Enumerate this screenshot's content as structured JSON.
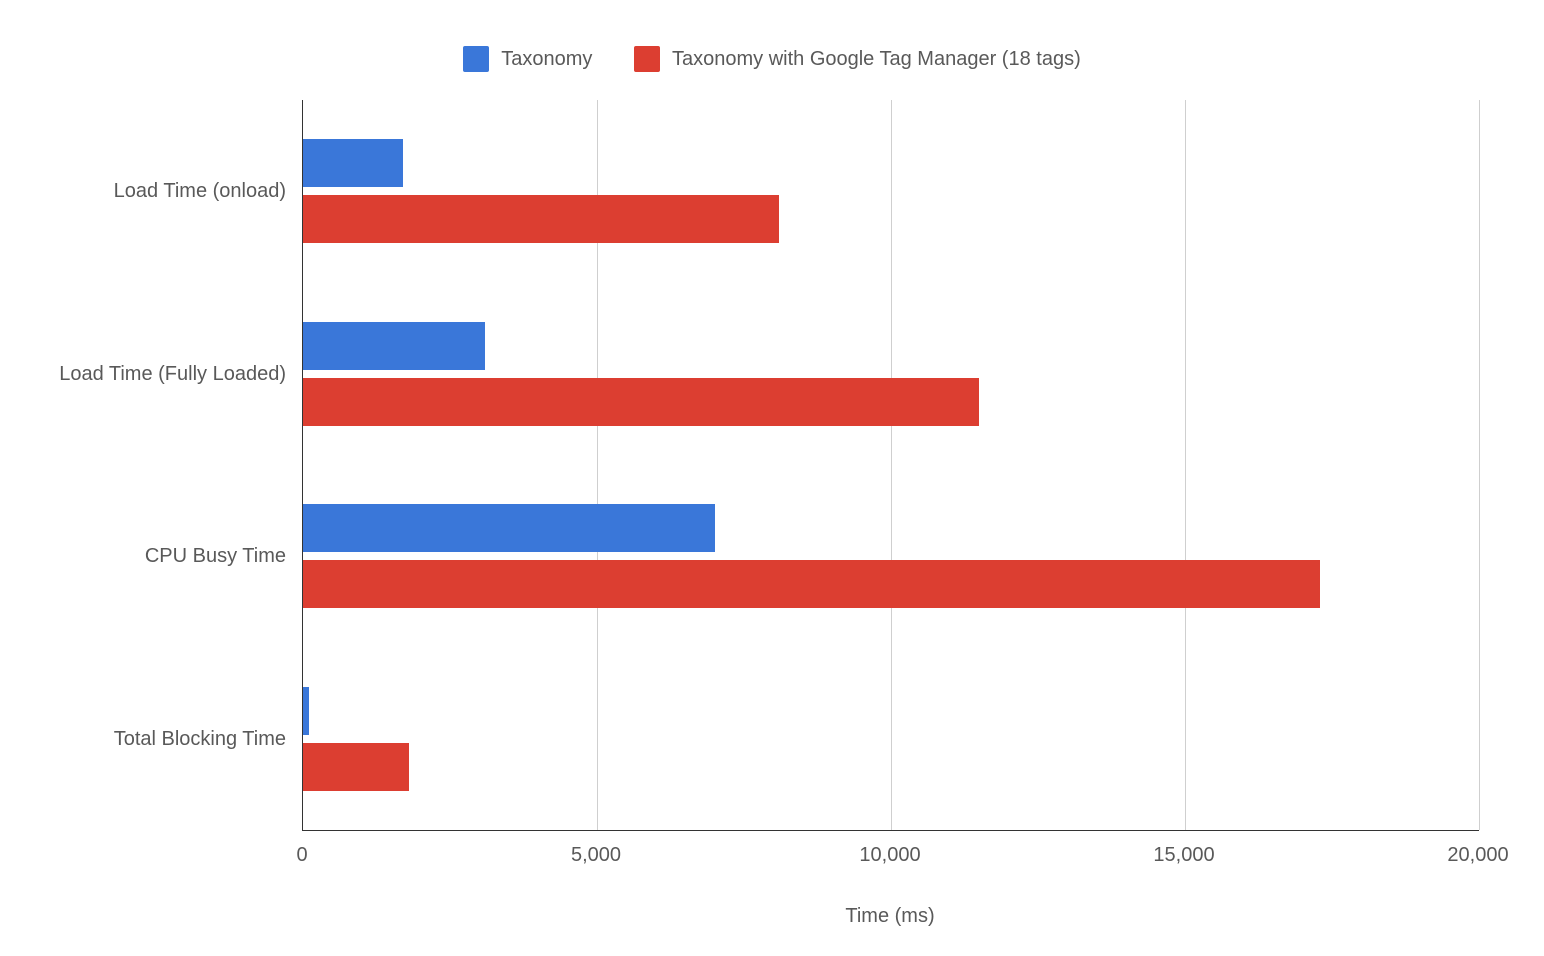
{
  "chart_data": {
    "type": "bar",
    "orientation": "horizontal",
    "categories": [
      "Load Time (onload)",
      "Load Time (Fully Loaded)",
      "CPU Busy Time",
      "Total Blocking Time"
    ],
    "series": [
      {
        "name": "Taxonomy",
        "color": "#3a77d9",
        "values": [
          1700,
          3100,
          7000,
          100
        ]
      },
      {
        "name": "Taxonomy with Google Tag Manager (18 tags)",
        "color": "#dc3e31",
        "values": [
          8100,
          11500,
          17300,
          1800
        ]
      }
    ],
    "xlabel": "Time (ms)",
    "ylabel": "",
    "xlim": [
      0,
      20000
    ],
    "xticks": [
      0,
      5000,
      10000,
      15000,
      20000
    ],
    "xtick_labels": [
      "0",
      "5,000",
      "10,000",
      "15,000",
      "20,000"
    ]
  }
}
